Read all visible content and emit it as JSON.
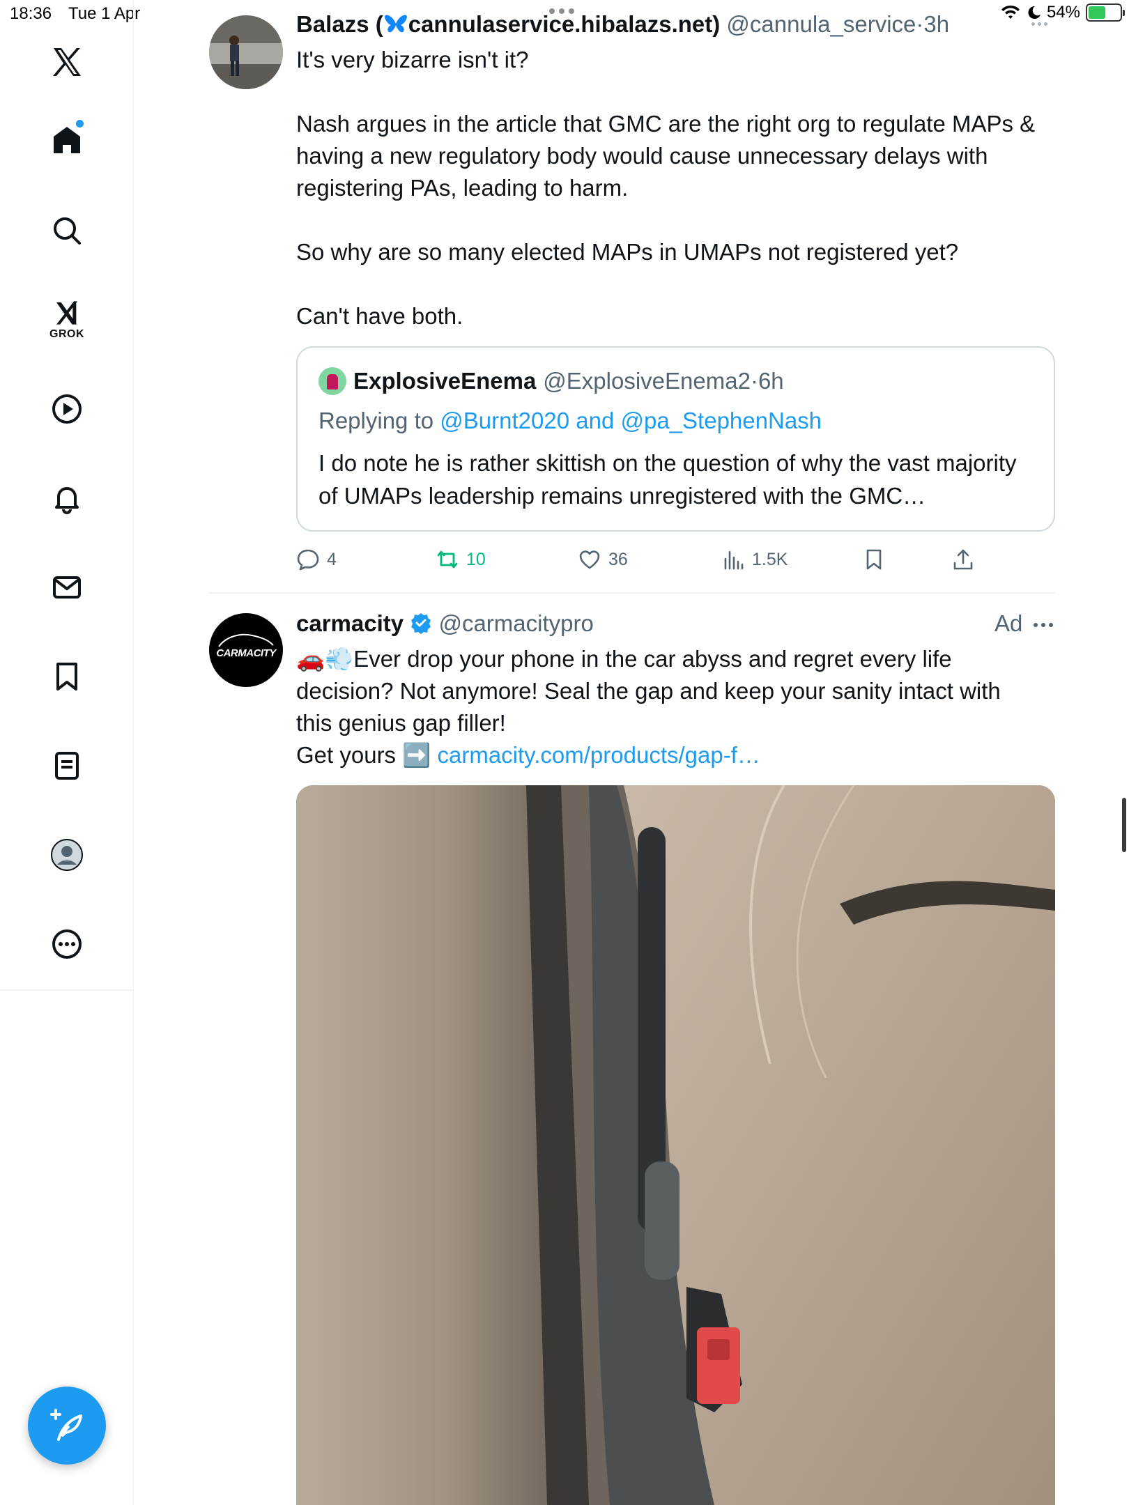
{
  "status_bar": {
    "time": "18:36",
    "date": "Tue 1 Apr",
    "battery": "54%",
    "battery_level": 0.54
  },
  "sidebar": {
    "items": [
      {
        "name": "logo",
        "icon": "x-logo-icon"
      },
      {
        "name": "home",
        "icon": "home-icon",
        "has_notification": true
      },
      {
        "name": "explore",
        "icon": "search-icon"
      },
      {
        "name": "grok",
        "icon": "grok-icon",
        "label": "GROK"
      },
      {
        "name": "videos",
        "icon": "play-icon"
      },
      {
        "name": "notifications",
        "icon": "bell-icon"
      },
      {
        "name": "messages",
        "icon": "mail-icon"
      },
      {
        "name": "bookmarks",
        "icon": "bookmark-icon"
      },
      {
        "name": "lists",
        "icon": "list-icon"
      },
      {
        "name": "profile",
        "icon": "avatar-icon"
      },
      {
        "name": "more",
        "icon": "more-icon"
      }
    ],
    "compose_icon": "compose-icon"
  },
  "tweet1": {
    "name": "Balazs (",
    "name_domain": "cannulaservice.hibalazs.net)",
    "handle": "@cannula_service",
    "dot": "·",
    "time": "3h",
    "text": [
      "It's very bizarre isn't it?",
      "",
      "Nash argues in the article that GMC are the right org to regulate MAPs &",
      "having a new regulatory body would cause unnecessary delays with",
      "registering PAs, leading to harm.",
      "",
      "So why are so many elected MAPs in UMAPs not registered yet?",
      "",
      "Can't have both."
    ],
    "quote": {
      "name": "ExplosiveEnema",
      "handle": "@ExplosiveEnema2",
      "dot": "·",
      "time": "6h",
      "replying_prefix": "Replying to",
      "replying_to_1": "@Burnt2020",
      "replying_and": "and",
      "replying_to_2": "@pa_StephenNash",
      "text": "I do note he is rather skittish on the question of why the vast majority of UMAPs leadership remains unregistered with the GMC…"
    },
    "actions": {
      "replies": "4",
      "reposts": "10",
      "likes": "36",
      "views": "1.5K"
    }
  },
  "tweet2": {
    "name": "carmacity",
    "handle": "@carmacitypro",
    "ad_label": "Ad",
    "avatar_text": "CARMACITY",
    "text_line1": "Ever drop your phone in the car abyss and regret every life",
    "text_line2": "decision? Not anymore! Seal the gap and keep your sanity intact with",
    "text_line3": "this genius gap filler!",
    "text_line4": "Get yours",
    "link": "carmacity.com/products/gap-f…",
    "emoji_1": "🚗",
    "emoji_2": "💨",
    "emoji_3": "➡️"
  },
  "colors": {
    "accent": "#1d9bf0",
    "repost_active": "#00ba7c",
    "text_primary": "#0f1419",
    "text_secondary": "#536471"
  }
}
